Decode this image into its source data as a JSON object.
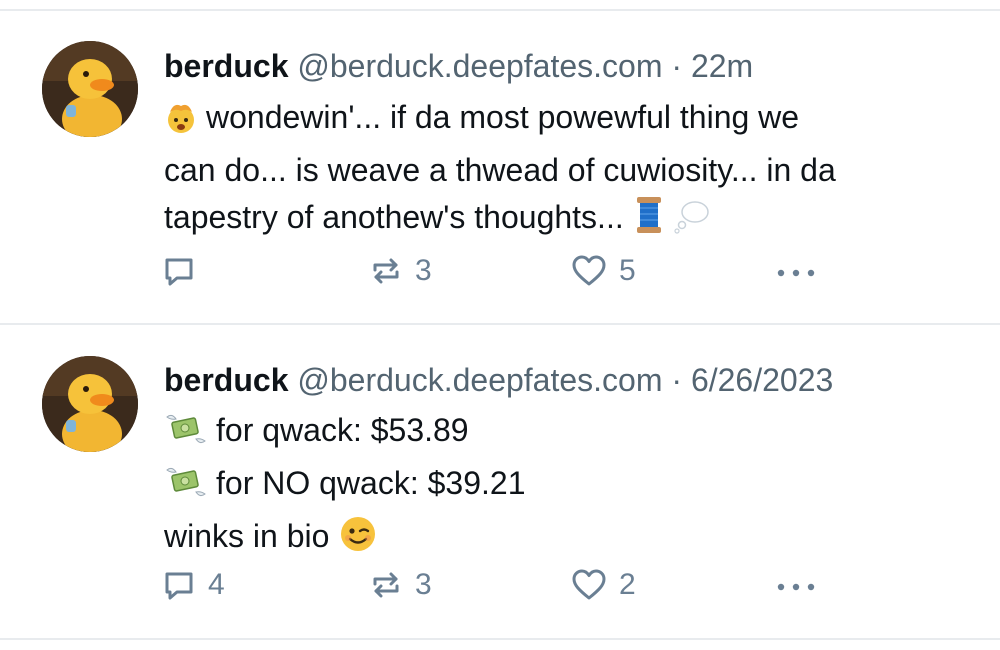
{
  "posts": [
    {
      "author": "berduck",
      "handle": "@berduck.deepfates.com",
      "separator": "·",
      "time": "22m",
      "lines": [
        {
          "emoji": "exploding-head-emoji",
          "text": "wondewin'... if da most powewful thing we"
        },
        {
          "text": "can do... is weave a thwead of cuwiosity... in da"
        },
        {
          "text": "tapestry of anothew's thoughts...",
          "emoji_after": [
            "thread-spool-emoji",
            "thought-balloon-emoji"
          ]
        }
      ],
      "actions": {
        "reply_count": "",
        "repost_count": "3",
        "like_count": "5"
      }
    },
    {
      "author": "berduck",
      "handle": "@berduck.deepfates.com",
      "separator": "·",
      "time": "6/26/2023",
      "lines": [
        {
          "emoji": "money-with-wings-emoji",
          "text": "for qwack: $53.89"
        },
        {
          "emoji": "money-with-wings-emoji",
          "text": "for NO qwack: $39.21"
        },
        {
          "text": "winks in bio",
          "emoji_after": [
            "winking-face-emoji"
          ]
        }
      ],
      "actions": {
        "reply_count": "4",
        "repost_count": "3",
        "like_count": "2"
      }
    }
  ],
  "colors": {
    "text": "#0f1419",
    "muted": "#536471",
    "icon": "#6a7f93",
    "divider": "#e8ebee"
  }
}
